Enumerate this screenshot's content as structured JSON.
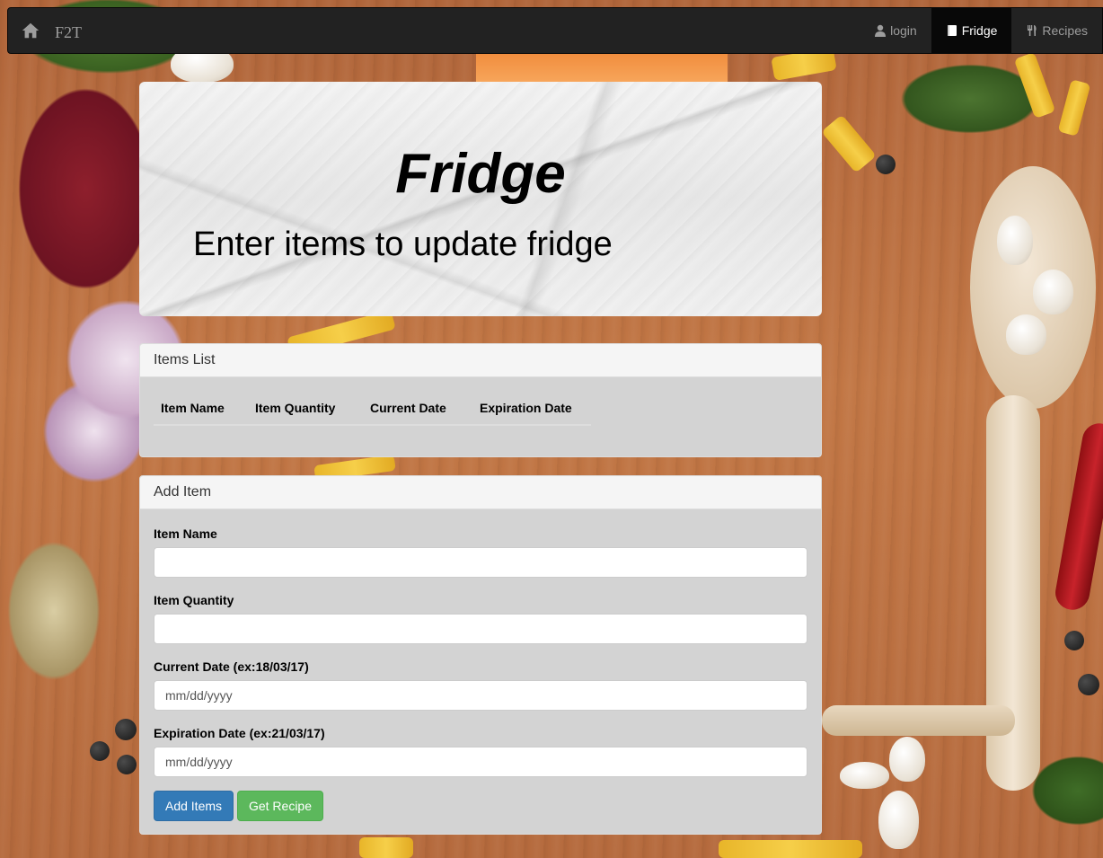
{
  "navbar": {
    "brand": "F2T",
    "items": [
      {
        "label": "login",
        "icon": "user-icon",
        "active": false
      },
      {
        "label": "Fridge",
        "icon": "book-icon",
        "active": true
      },
      {
        "label": "Recipes",
        "icon": "cutlery-icon",
        "active": false
      }
    ]
  },
  "jumbotron": {
    "title": "Fridge",
    "subtitle": "Enter items to update fridge"
  },
  "items_panel": {
    "heading": "Items List",
    "columns": [
      "Item Name",
      "Item Quantity",
      "Current Date",
      "Expiration Date"
    ]
  },
  "add_panel": {
    "heading": "Add Item",
    "fields": [
      {
        "label": "Item Name",
        "placeholder": ""
      },
      {
        "label": "Item Quantity",
        "placeholder": ""
      },
      {
        "label": "Current Date (ex:18/03/17)",
        "placeholder": "mm/dd/yyyy"
      },
      {
        "label": "Expiration Date (ex:21/03/17)",
        "placeholder": "mm/dd/yyyy"
      }
    ],
    "buttons": {
      "add": "Add Items",
      "recipe": "Get Recipe"
    }
  },
  "colors": {
    "navbar_bg": "#222222",
    "primary": "#337ab7",
    "success": "#5cb85c",
    "panel_bg": "#d3d3d3"
  }
}
